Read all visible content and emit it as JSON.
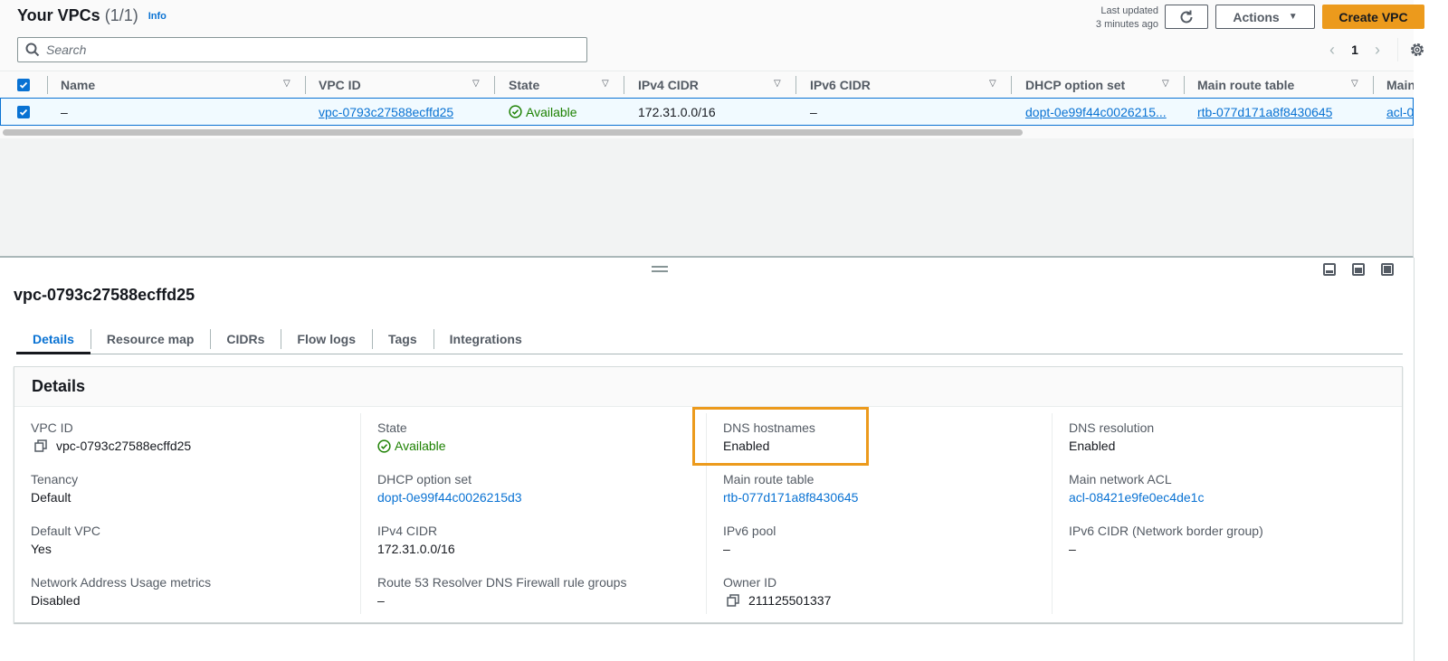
{
  "header": {
    "title": "Your VPCs",
    "count": "(1/1)",
    "info_label": "Info",
    "last_updated_line1": "Last updated",
    "last_updated_line2": "3 minutes ago",
    "actions_label": "Actions",
    "create_label": "Create VPC"
  },
  "search": {
    "placeholder": "Search",
    "value": ""
  },
  "pagination": {
    "current_page": "1"
  },
  "table": {
    "columns": [
      "Name",
      "VPC ID",
      "State",
      "IPv4 CIDR",
      "IPv6 CIDR",
      "DHCP option set",
      "Main route table",
      "Main"
    ],
    "rows": [
      {
        "selected": true,
        "name": "–",
        "vpc_id": "vpc-0793c27588ecffd25",
        "state": "Available",
        "ipv4_cidr": "172.31.0.0/16",
        "ipv6_cidr": "–",
        "dhcp_option_set": "dopt-0e99f44c0026215...",
        "main_route_table": "rtb-077d171a8f8430645",
        "main_network_acl": "acl-0"
      }
    ]
  },
  "detail": {
    "title": "vpc-0793c27588ecffd25",
    "tabs": [
      {
        "label": "Details",
        "active": true
      },
      {
        "label": "Resource map",
        "active": false
      },
      {
        "label": "CIDRs",
        "active": false
      },
      {
        "label": "Flow logs",
        "active": false
      },
      {
        "label": "Tags",
        "active": false
      },
      {
        "label": "Integrations",
        "active": false
      }
    ],
    "card_title": "Details",
    "fields": {
      "vpc_id": {
        "label": "VPC ID",
        "value": "vpc-0793c27588ecffd25"
      },
      "tenancy": {
        "label": "Tenancy",
        "value": "Default"
      },
      "default_vpc": {
        "label": "Default VPC",
        "value": "Yes"
      },
      "nau_metrics": {
        "label": "Network Address Usage metrics",
        "value": "Disabled"
      },
      "state": {
        "label": "State",
        "value": "Available"
      },
      "dhcp": {
        "label": "DHCP option set",
        "value": "dopt-0e99f44c0026215d3"
      },
      "ipv4_cidr": {
        "label": "IPv4 CIDR",
        "value": "172.31.0.0/16"
      },
      "r53_firewall": {
        "label": "Route 53 Resolver DNS Firewall rule groups",
        "value": "–"
      },
      "dns_hostnames": {
        "label": "DNS hostnames",
        "value": "Enabled"
      },
      "main_route_table": {
        "label": "Main route table",
        "value": "rtb-077d171a8f8430645"
      },
      "ipv6_pool": {
        "label": "IPv6 pool",
        "value": "–"
      },
      "owner_id": {
        "label": "Owner ID",
        "value": "211125501337"
      },
      "dns_resolution": {
        "label": "DNS resolution",
        "value": "Enabled"
      },
      "main_acl": {
        "label": "Main network ACL",
        "value": "acl-08421e9fe0ec4de1c"
      },
      "ipv6_cidr_nbg": {
        "label": "IPv6 CIDR (Network border group)",
        "value": "–"
      }
    }
  },
  "colors": {
    "primary_button": "#ec9a1c",
    "link": "#0972d3",
    "success": "#1d8102",
    "highlight": "#ec9a1c"
  }
}
